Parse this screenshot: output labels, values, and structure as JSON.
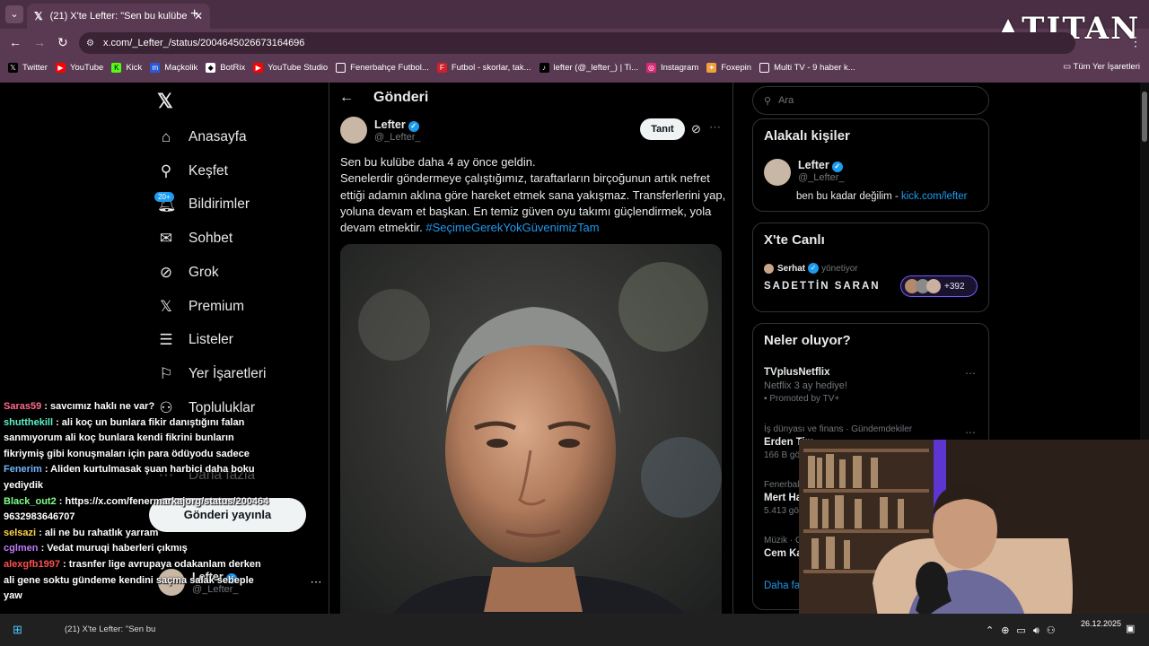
{
  "browser": {
    "tab_title": "(21) X'te Lefter: \"Sen bu kulübe",
    "url": "x.com/_Lefter_/status/2004645026673164696",
    "overlay_logo": "TITAN",
    "bookmarks": [
      "Twitter",
      "YouTube",
      "Kick",
      "Maçkolik",
      "BotRix",
      "YouTube Studio",
      "Fenerbahçe Futbol...",
      "Futbol - skorlar, tak...",
      "lefter (@_lefter_) | Ti...",
      "Instagram",
      "Foxepin",
      "Multi TV - 9 haber k..."
    ],
    "all_bookmarks": "Tüm Yer İşaretleri"
  },
  "nav": {
    "items": [
      "Anasayfa",
      "Keşfet",
      "Bildirimler",
      "Sohbet",
      "Grok",
      "Premium",
      "Listeler",
      "Yer İşaretleri",
      "Topluluklar",
      "Daha fazla"
    ],
    "badge": "20+",
    "post_button": "Gönderi yayınla",
    "account_name": "Lefter",
    "account_handle": "@_Lefter_"
  },
  "post": {
    "header": "Gönderi",
    "author_name": "Lefter",
    "author_handle": "@_Lefter_",
    "follow_label": "Tanıt",
    "line1": "Sen bu kulübe daha 4 ay önce geldin.",
    "line2": "Senelerdir göndermeye çalıştığımız, taraftarların birçoğunun artık nefret ettiği adamın aklına göre hareket etmek sana yakışmaz. Transferlerini yap, yoluna devam et başkan. En temiz güven oyu takımı güçlendirmek, yola devam etmektir.",
    "hashtag": "#SeçimeGerekYokGüvenimizTam"
  },
  "sidebar": {
    "search_placeholder": "Ara",
    "related_title": "Alakalı kişiler",
    "related_name": "Lefter",
    "related_handle": "@_Lefter_",
    "related_bio": "ben bu kadar değilim - ",
    "related_link": "kick.com/lefter",
    "live_title": "X'te Canlı",
    "live_host": "Serhat",
    "live_role": "yönetiyor",
    "live_name": "SADETTİN SARAN",
    "live_count": "+392",
    "trends_title": "Neler oluyor?",
    "t1_name": "TVplusNetflix",
    "t1_desc": "Netflix 3 ay hediye!",
    "t1_promo": "Promoted by TV+",
    "t2_cat": "İş dünyası ve finans · Gündemdekiler",
    "t2_name": "Erden Tim",
    "t2_count": "166 B gö",
    "t3_cat": "Fenerbal",
    "t3_name": "Mert Ha",
    "t3_count": "5.413 gö",
    "t4_cat": "Müzik · G",
    "t4_name": "Cem Ka",
    "more": "Daha fa"
  },
  "chat": [
    {
      "user": "Saras59",
      "color": "#ff6b8a",
      "msg": " : savcımız haklı ne var?"
    },
    {
      "user": "shutthekill",
      "color": "#5cf0c8",
      "msg": " : ali koç un bunlara fikir danıştığını falan sanmıyorum ali koç bunlara kendi fikrini bunların fikriymiş gibi konuşmaları için para ödüyodu sadece"
    },
    {
      "user": "Fenerim",
      "color": "#6fb8ff",
      "msg": " : Aliden kurtulmasak şuan harbici daha boku yediydik"
    },
    {
      "user": "Black_out2",
      "color": "#7dff8a",
      "msg": " : https://x.com/fenermarkajorg/status/2004649632983646707"
    },
    {
      "user": "selsazi",
      "color": "#ffd24a",
      "msg": " : ali ne bu rahatlık yarram"
    },
    {
      "user": "cglmen",
      "color": "#c07bff",
      "msg": " : Vedat muruqi haberleri çıkmış"
    },
    {
      "user": "alexgfb1997",
      "color": "#ff4f4f",
      "msg": " : trasnfer lige avrupaya odakanlam derken ali gene soktu gündeme kendini saçma salak sebeple yaw"
    }
  ],
  "taskbar": {
    "tab": "(21) X'te Lefter: \"Sen bu",
    "date": "26.12.2025"
  }
}
